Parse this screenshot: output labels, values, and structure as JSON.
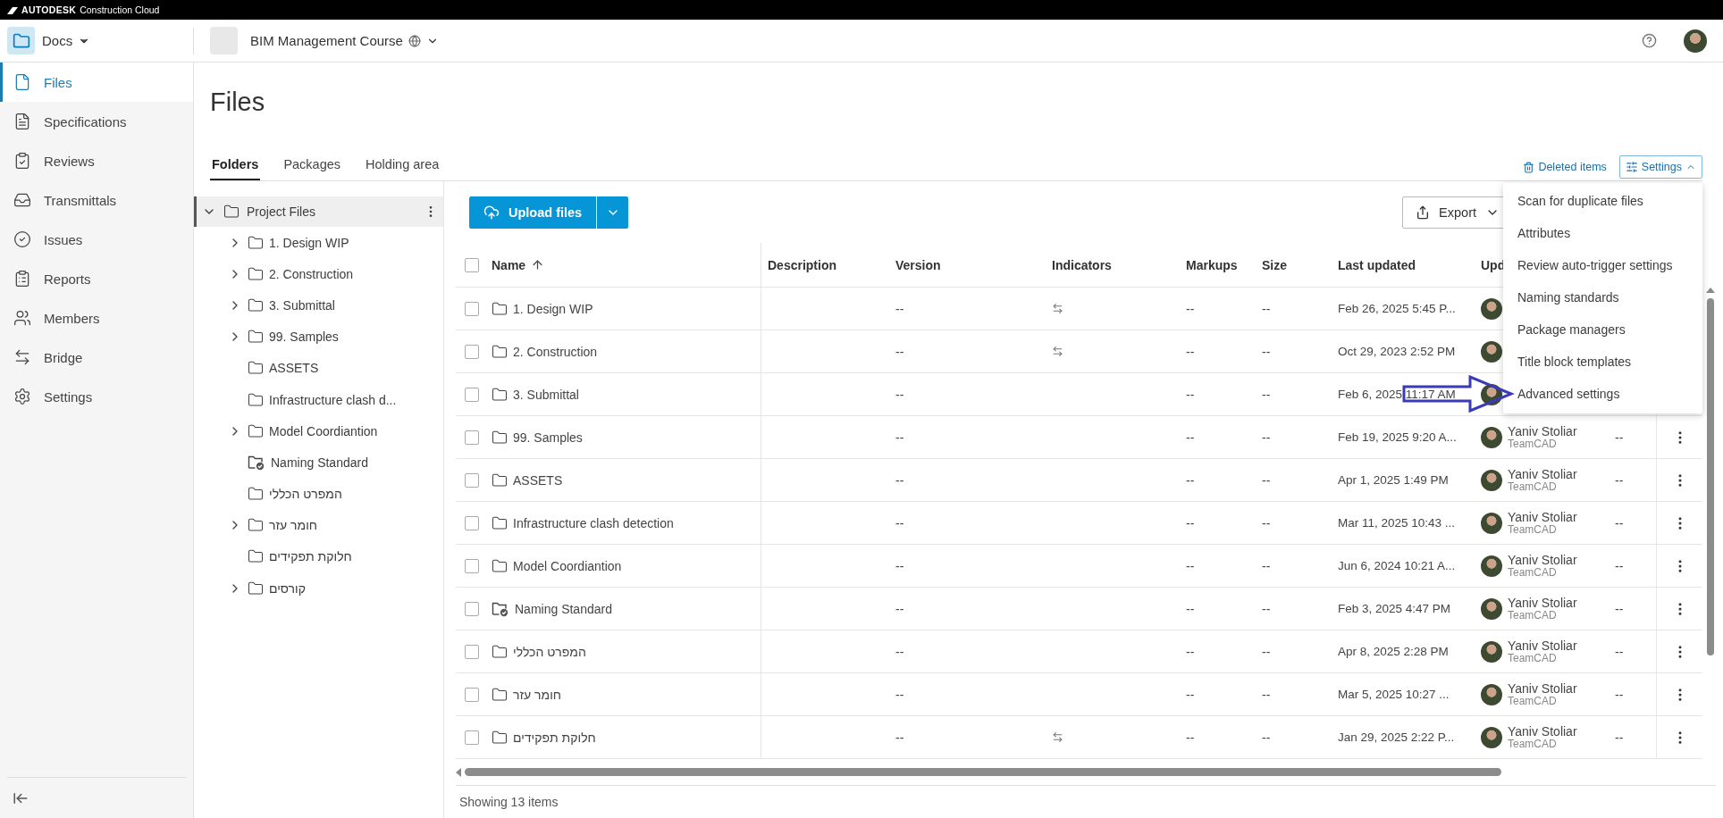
{
  "top_bar": {
    "brand": "AUTODESK",
    "product": "Construction Cloud"
  },
  "header": {
    "module": "Docs",
    "project": "BIM Management Course"
  },
  "sidebar": {
    "items": [
      {
        "label": "Files",
        "selected": true
      },
      {
        "label": "Specifications",
        "selected": false
      },
      {
        "label": "Reviews",
        "selected": false
      },
      {
        "label": "Transmittals",
        "selected": false
      },
      {
        "label": "Issues",
        "selected": false
      },
      {
        "label": "Reports",
        "selected": false
      },
      {
        "label": "Members",
        "selected": false
      },
      {
        "label": "Bridge",
        "selected": false
      },
      {
        "label": "Settings",
        "selected": false
      }
    ]
  },
  "page": {
    "title": "Files"
  },
  "tabs": [
    {
      "label": "Folders",
      "selected": true
    },
    {
      "label": "Packages",
      "selected": false
    },
    {
      "label": "Holding area",
      "selected": false
    }
  ],
  "deleted_items": "Deleted items",
  "settings_button": {
    "label": "Settings",
    "expanded": true
  },
  "settings_menu": [
    "Scan for duplicate files",
    "Attributes",
    "Review auto-trigger settings",
    "Naming standards",
    "Package managers",
    "Title block templates",
    "Advanced settings"
  ],
  "tree": {
    "label": "Project Files",
    "expanded": true,
    "selected": true,
    "children": [
      {
        "label": "1. Design WIP",
        "kind": "folder",
        "has_children": true
      },
      {
        "label": "2. Construction",
        "kind": "folder",
        "has_children": true
      },
      {
        "label": "3. Submittal",
        "kind": "folder",
        "has_children": true
      },
      {
        "label": "99. Samples",
        "kind": "folder",
        "has_children": true
      },
      {
        "label": "ASSETS",
        "kind": "folder",
        "has_children": false
      },
      {
        "label": "Infrastructure clash d...",
        "kind": "folder",
        "has_children": false
      },
      {
        "label": "Model Coordiantion",
        "kind": "folder",
        "has_children": true
      },
      {
        "label": "Naming Standard",
        "kind": "standard",
        "has_children": false
      },
      {
        "label": "המפרט הכללי",
        "kind": "folder",
        "has_children": false
      },
      {
        "label": "חומר עזר",
        "kind": "folder",
        "has_children": true
      },
      {
        "label": "חלוקת תפקידים",
        "kind": "folder",
        "has_children": false
      },
      {
        "label": "קורסים",
        "kind": "folder",
        "has_children": true
      }
    ]
  },
  "toolbar": {
    "upload": "Upload files",
    "export": "Export"
  },
  "table": {
    "all_checked": false,
    "columns": [
      {
        "label": "Name",
        "sorted": true
      },
      {
        "label": "Description"
      },
      {
        "label": "Version"
      },
      {
        "label": "Indicators"
      },
      {
        "label": "Markups"
      },
      {
        "label": "Size"
      },
      {
        "label": "Last updated"
      },
      {
        "label": "Upd"
      }
    ],
    "rows": [
      {
        "name": "1. Design WIP",
        "kind": "folder",
        "checked": false,
        "version": "--",
        "indicator": true,
        "markups": "--",
        "size": "--",
        "last_updated": "Feb 26, 2025 5:45 P..."
      },
      {
        "name": "2. Construction",
        "kind": "folder",
        "checked": false,
        "version": "--",
        "indicator": true,
        "markups": "--",
        "size": "--",
        "last_updated": "Oct 29, 2023 2:52 PM"
      },
      {
        "name": "3. Submittal",
        "kind": "folder",
        "checked": false,
        "version": "--",
        "indicator": false,
        "markups": "--",
        "size": "--",
        "last_updated": "Feb 6, 2025 11:17 AM"
      },
      {
        "name": "99. Samples",
        "kind": "folder",
        "checked": false,
        "version": "--",
        "indicator": false,
        "markups": "--",
        "size": "--",
        "last_updated": "Feb 19, 2025 9:20 A...",
        "updated_by": "Yaniv Stoliar",
        "company": "TeamCAD",
        "column_10": "--"
      },
      {
        "name": "ASSETS",
        "kind": "folder",
        "checked": false,
        "version": "--",
        "indicator": false,
        "markups": "--",
        "size": "--",
        "last_updated": "Apr 1, 2025 1:49 PM",
        "updated_by": "Yaniv Stoliar",
        "company": "TeamCAD",
        "column_10": "--"
      },
      {
        "name": "Infrastructure clash detection",
        "kind": "folder",
        "checked": false,
        "version": "--",
        "indicator": false,
        "markups": "--",
        "size": "--",
        "last_updated": "Mar 11, 2025 10:43 ...",
        "updated_by": "Yaniv Stoliar",
        "company": "TeamCAD",
        "column_10": "--"
      },
      {
        "name": "Model Coordiantion",
        "kind": "folder",
        "checked": false,
        "version": "--",
        "indicator": false,
        "markups": "--",
        "size": "--",
        "last_updated": "Jun 6, 2024 10:21 A...",
        "updated_by": "Yaniv Stoliar",
        "company": "TeamCAD",
        "column_10": "--"
      },
      {
        "name": "Naming Standard",
        "kind": "standard",
        "checked": false,
        "version": "--",
        "indicator": false,
        "markups": "--",
        "size": "--",
        "last_updated": "Feb 3, 2025 4:47 PM",
        "updated_by": "Yaniv Stoliar",
        "company": "TeamCAD",
        "column_10": "--"
      },
      {
        "name": "המפרט הכללי",
        "kind": "folder",
        "checked": false,
        "version": "--",
        "indicator": false,
        "markups": "--",
        "size": "--",
        "last_updated": "Apr 8, 2025 2:28 PM",
        "updated_by": "Yaniv Stoliar",
        "company": "TeamCAD",
        "column_10": "--"
      },
      {
        "name": "חומר עזר",
        "kind": "folder",
        "checked": false,
        "version": "--",
        "indicator": false,
        "markups": "--",
        "size": "--",
        "last_updated": "Mar 5, 2025 10:27 ...",
        "updated_by": "Yaniv Stoliar",
        "company": "TeamCAD",
        "column_10": "--"
      },
      {
        "name": "חלוקת תפקידים",
        "kind": "folder",
        "checked": false,
        "version": "--",
        "indicator": true,
        "markups": "--",
        "size": "--",
        "last_updated": "Jan 29, 2025 2:22 P...",
        "updated_by": "Yaniv Stoliar",
        "company": "TeamCAD",
        "column_10": "--"
      }
    ]
  },
  "footer": "Showing 13 items"
}
